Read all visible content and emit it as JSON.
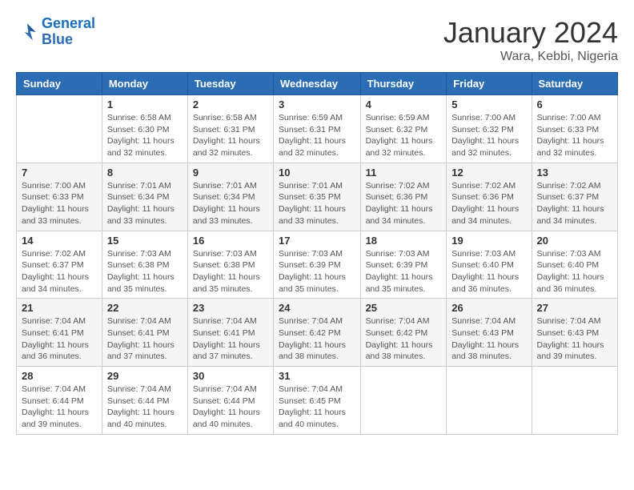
{
  "logo": {
    "general": "General",
    "blue": "Blue"
  },
  "header": {
    "title": "January 2024",
    "location": "Wara, Kebbi, Nigeria"
  },
  "days_of_week": [
    "Sunday",
    "Monday",
    "Tuesday",
    "Wednesday",
    "Thursday",
    "Friday",
    "Saturday"
  ],
  "weeks": [
    [
      {
        "num": "",
        "sunrise": "",
        "sunset": "",
        "daylight": ""
      },
      {
        "num": "1",
        "sunrise": "Sunrise: 6:58 AM",
        "sunset": "Sunset: 6:30 PM",
        "daylight": "Daylight: 11 hours and 32 minutes."
      },
      {
        "num": "2",
        "sunrise": "Sunrise: 6:58 AM",
        "sunset": "Sunset: 6:31 PM",
        "daylight": "Daylight: 11 hours and 32 minutes."
      },
      {
        "num": "3",
        "sunrise": "Sunrise: 6:59 AM",
        "sunset": "Sunset: 6:31 PM",
        "daylight": "Daylight: 11 hours and 32 minutes."
      },
      {
        "num": "4",
        "sunrise": "Sunrise: 6:59 AM",
        "sunset": "Sunset: 6:32 PM",
        "daylight": "Daylight: 11 hours and 32 minutes."
      },
      {
        "num": "5",
        "sunrise": "Sunrise: 7:00 AM",
        "sunset": "Sunset: 6:32 PM",
        "daylight": "Daylight: 11 hours and 32 minutes."
      },
      {
        "num": "6",
        "sunrise": "Sunrise: 7:00 AM",
        "sunset": "Sunset: 6:33 PM",
        "daylight": "Daylight: 11 hours and 32 minutes."
      }
    ],
    [
      {
        "num": "7",
        "sunrise": "Sunrise: 7:00 AM",
        "sunset": "Sunset: 6:33 PM",
        "daylight": "Daylight: 11 hours and 33 minutes."
      },
      {
        "num": "8",
        "sunrise": "Sunrise: 7:01 AM",
        "sunset": "Sunset: 6:34 PM",
        "daylight": "Daylight: 11 hours and 33 minutes."
      },
      {
        "num": "9",
        "sunrise": "Sunrise: 7:01 AM",
        "sunset": "Sunset: 6:34 PM",
        "daylight": "Daylight: 11 hours and 33 minutes."
      },
      {
        "num": "10",
        "sunrise": "Sunrise: 7:01 AM",
        "sunset": "Sunset: 6:35 PM",
        "daylight": "Daylight: 11 hours and 33 minutes."
      },
      {
        "num": "11",
        "sunrise": "Sunrise: 7:02 AM",
        "sunset": "Sunset: 6:36 PM",
        "daylight": "Daylight: 11 hours and 34 minutes."
      },
      {
        "num": "12",
        "sunrise": "Sunrise: 7:02 AM",
        "sunset": "Sunset: 6:36 PM",
        "daylight": "Daylight: 11 hours and 34 minutes."
      },
      {
        "num": "13",
        "sunrise": "Sunrise: 7:02 AM",
        "sunset": "Sunset: 6:37 PM",
        "daylight": "Daylight: 11 hours and 34 minutes."
      }
    ],
    [
      {
        "num": "14",
        "sunrise": "Sunrise: 7:02 AM",
        "sunset": "Sunset: 6:37 PM",
        "daylight": "Daylight: 11 hours and 34 minutes."
      },
      {
        "num": "15",
        "sunrise": "Sunrise: 7:03 AM",
        "sunset": "Sunset: 6:38 PM",
        "daylight": "Daylight: 11 hours and 35 minutes."
      },
      {
        "num": "16",
        "sunrise": "Sunrise: 7:03 AM",
        "sunset": "Sunset: 6:38 PM",
        "daylight": "Daylight: 11 hours and 35 minutes."
      },
      {
        "num": "17",
        "sunrise": "Sunrise: 7:03 AM",
        "sunset": "Sunset: 6:39 PM",
        "daylight": "Daylight: 11 hours and 35 minutes."
      },
      {
        "num": "18",
        "sunrise": "Sunrise: 7:03 AM",
        "sunset": "Sunset: 6:39 PM",
        "daylight": "Daylight: 11 hours and 35 minutes."
      },
      {
        "num": "19",
        "sunrise": "Sunrise: 7:03 AM",
        "sunset": "Sunset: 6:40 PM",
        "daylight": "Daylight: 11 hours and 36 minutes."
      },
      {
        "num": "20",
        "sunrise": "Sunrise: 7:03 AM",
        "sunset": "Sunset: 6:40 PM",
        "daylight": "Daylight: 11 hours and 36 minutes."
      }
    ],
    [
      {
        "num": "21",
        "sunrise": "Sunrise: 7:04 AM",
        "sunset": "Sunset: 6:41 PM",
        "daylight": "Daylight: 11 hours and 36 minutes."
      },
      {
        "num": "22",
        "sunrise": "Sunrise: 7:04 AM",
        "sunset": "Sunset: 6:41 PM",
        "daylight": "Daylight: 11 hours and 37 minutes."
      },
      {
        "num": "23",
        "sunrise": "Sunrise: 7:04 AM",
        "sunset": "Sunset: 6:41 PM",
        "daylight": "Daylight: 11 hours and 37 minutes."
      },
      {
        "num": "24",
        "sunrise": "Sunrise: 7:04 AM",
        "sunset": "Sunset: 6:42 PM",
        "daylight": "Daylight: 11 hours and 38 minutes."
      },
      {
        "num": "25",
        "sunrise": "Sunrise: 7:04 AM",
        "sunset": "Sunset: 6:42 PM",
        "daylight": "Daylight: 11 hours and 38 minutes."
      },
      {
        "num": "26",
        "sunrise": "Sunrise: 7:04 AM",
        "sunset": "Sunset: 6:43 PM",
        "daylight": "Daylight: 11 hours and 38 minutes."
      },
      {
        "num": "27",
        "sunrise": "Sunrise: 7:04 AM",
        "sunset": "Sunset: 6:43 PM",
        "daylight": "Daylight: 11 hours and 39 minutes."
      }
    ],
    [
      {
        "num": "28",
        "sunrise": "Sunrise: 7:04 AM",
        "sunset": "Sunset: 6:44 PM",
        "daylight": "Daylight: 11 hours and 39 minutes."
      },
      {
        "num": "29",
        "sunrise": "Sunrise: 7:04 AM",
        "sunset": "Sunset: 6:44 PM",
        "daylight": "Daylight: 11 hours and 40 minutes."
      },
      {
        "num": "30",
        "sunrise": "Sunrise: 7:04 AM",
        "sunset": "Sunset: 6:44 PM",
        "daylight": "Daylight: 11 hours and 40 minutes."
      },
      {
        "num": "31",
        "sunrise": "Sunrise: 7:04 AM",
        "sunset": "Sunset: 6:45 PM",
        "daylight": "Daylight: 11 hours and 40 minutes."
      },
      {
        "num": "",
        "sunrise": "",
        "sunset": "",
        "daylight": ""
      },
      {
        "num": "",
        "sunrise": "",
        "sunset": "",
        "daylight": ""
      },
      {
        "num": "",
        "sunrise": "",
        "sunset": "",
        "daylight": ""
      }
    ]
  ]
}
